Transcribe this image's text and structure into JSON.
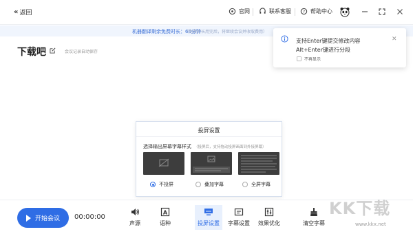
{
  "titlebar": {
    "back_label": "返回",
    "links": [
      {
        "label": "官网",
        "icon": "home-icon"
      },
      {
        "label": "联系客服",
        "icon": "headset-icon"
      },
      {
        "label": "帮助中心",
        "icon": "help-icon"
      }
    ]
  },
  "notice": {
    "main": "机器翻译剩余免费时长：60分钟",
    "secondary": "（免费时长用完后，将继续会议并收取费用）"
  },
  "page": {
    "title": "下载吧",
    "autosave": "会议记录自动保存"
  },
  "tooltip": {
    "line1": "支持Enter键提交修改内容",
    "line2": "Alt+Enter键进行分段",
    "checkbox_label": "不再显示"
  },
  "projection_dialog": {
    "title": "投屏设置",
    "subtitle": "选择输出屏幕字幕样式",
    "subtitle_note": "（投屏后，支持拖动投屏画面到外接屏幕）",
    "options": [
      {
        "label": "不投屏",
        "selected": true
      },
      {
        "label": "叠加字幕",
        "selected": false
      },
      {
        "label": "全屏字幕",
        "selected": false
      }
    ]
  },
  "bottom": {
    "start_label": "开始会议",
    "timer": "00:00:00",
    "tools": [
      {
        "label": "声源",
        "icon": "speaker-icon",
        "active": false
      },
      {
        "label": "语种",
        "icon": "language-icon",
        "active": false
      },
      {
        "label": "投屏设置",
        "icon": "screen-cast-icon",
        "active": true
      },
      {
        "label": "字幕设置",
        "icon": "subtitle-icon",
        "active": false
      },
      {
        "label": "效果优化",
        "icon": "equalizer-icon",
        "active": false
      },
      {
        "label": "清空字幕",
        "icon": "broom-icon",
        "active": false
      }
    ]
  },
  "watermark": {
    "brand": "KK下载",
    "url": "www.kkx.net"
  },
  "colors": {
    "accent": "#2f6de5",
    "notice_bg": "#f0f5fd",
    "preview_bg": "#3d3d3d"
  }
}
